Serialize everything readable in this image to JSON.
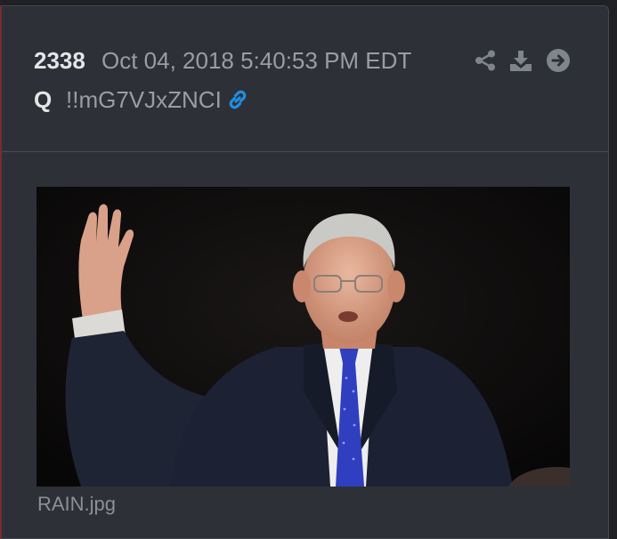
{
  "post": {
    "number": "2338",
    "date": "Oct 04, 2018 5:40:53 PM EDT",
    "author": "Q",
    "tripcode": "!!mG7VJxZNCI",
    "link_icon": "link-icon"
  },
  "actions": {
    "share_icon": "share-icon",
    "download_icon": "download-icon",
    "goto_icon": "arrow-circle-right-icon"
  },
  "attachment": {
    "filename": "RAIN.jpg",
    "image_subject": "man in dark suit and blue tie raising right hand"
  },
  "colors": {
    "card_bg": "#2d3037",
    "page_bg": "#1f2125",
    "text_primary": "#e4e5e7",
    "text_secondary": "#9a9da3",
    "link_blue": "#1e8fe0",
    "accent_red_border": "#7a2a2f"
  }
}
